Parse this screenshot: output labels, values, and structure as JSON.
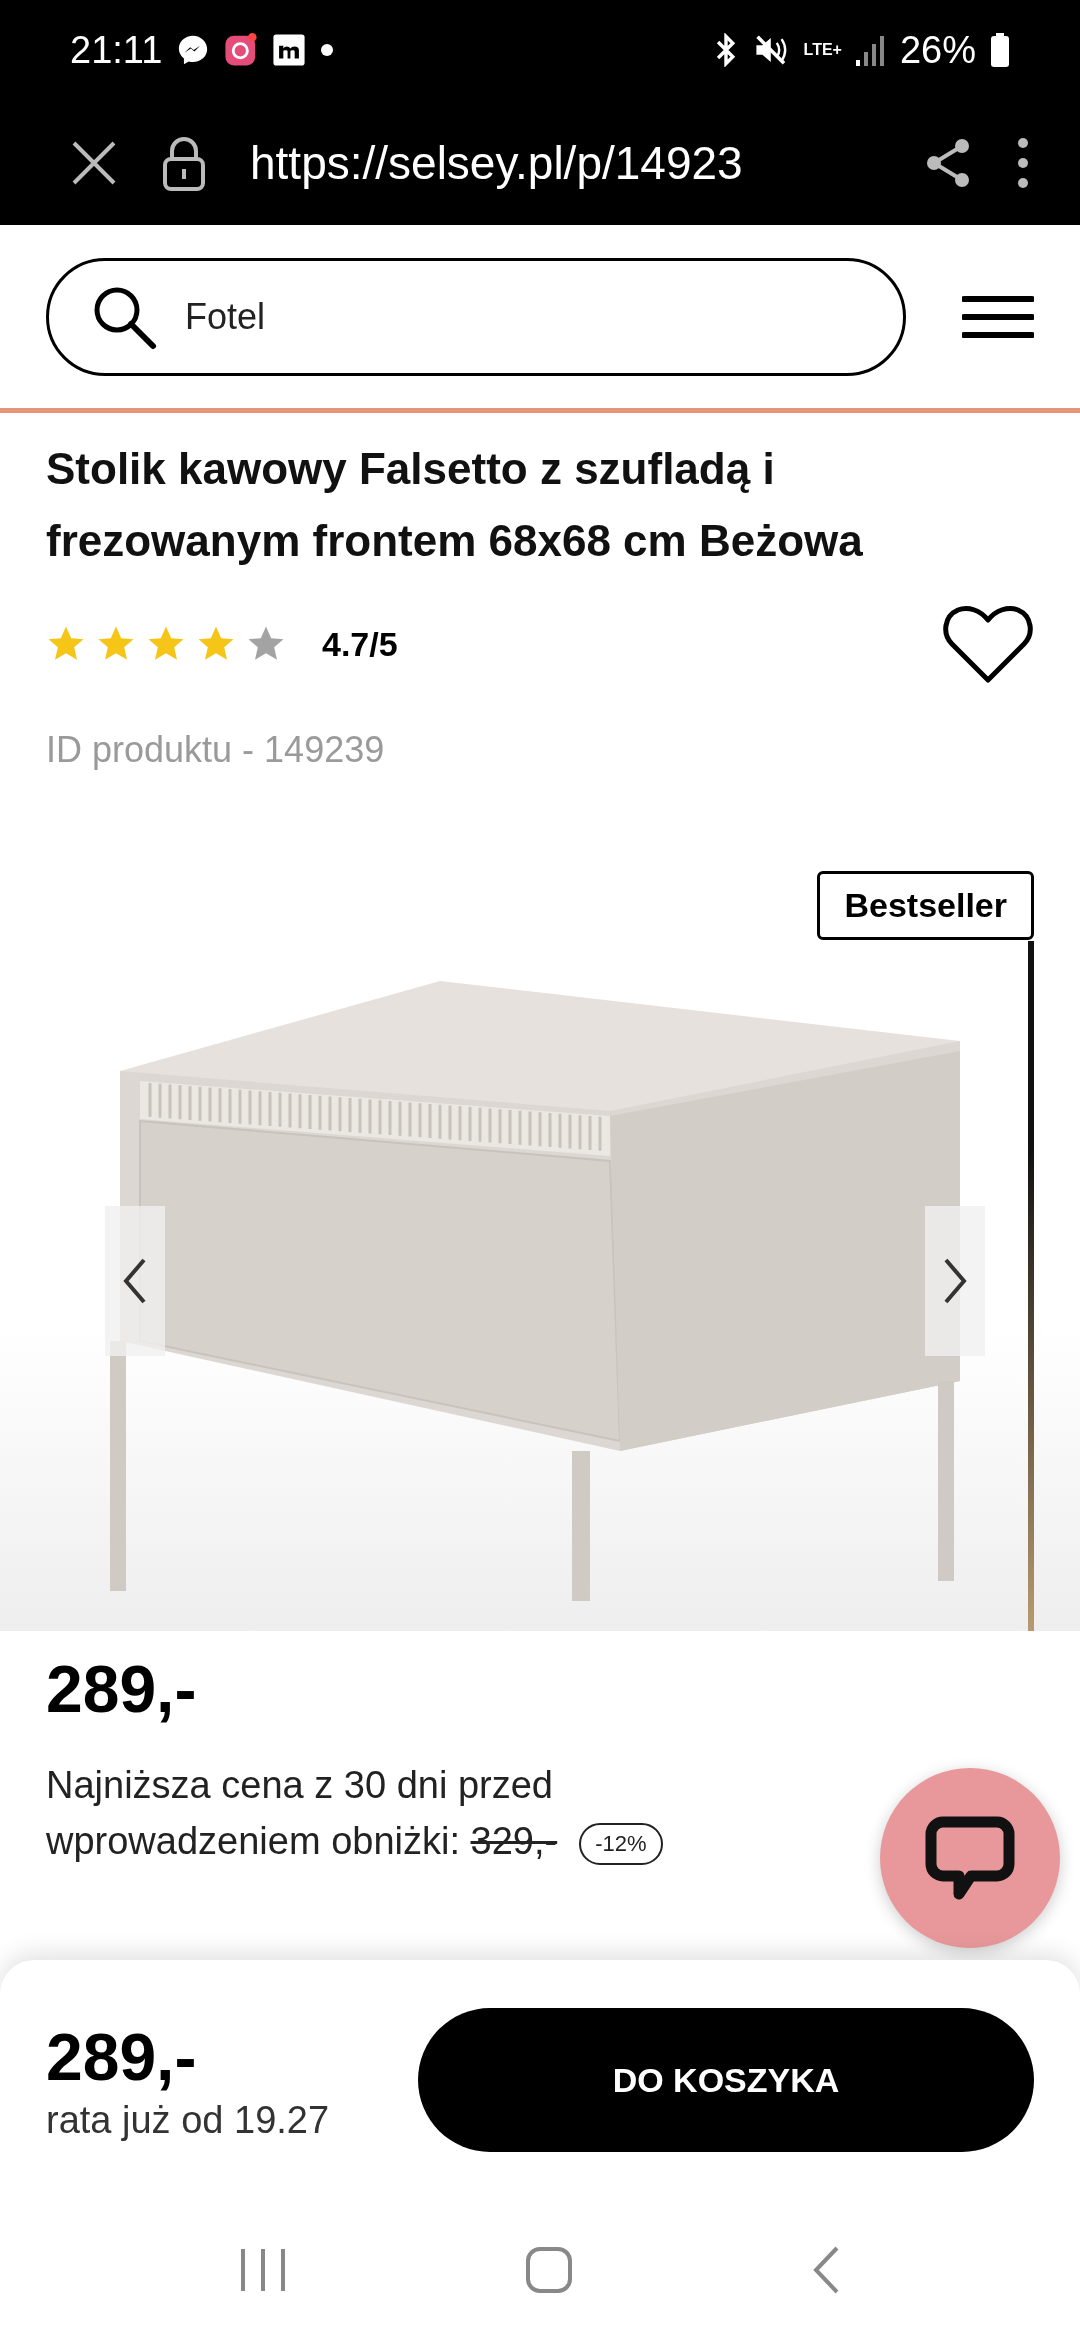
{
  "status_bar": {
    "time": "21:11",
    "network": "LTE+",
    "battery": "26%"
  },
  "browser": {
    "url": "https://selsey.pl/p/14923"
  },
  "search": {
    "value": "Fotel"
  },
  "product": {
    "title": "Stolik kawowy Falsetto z szufladą i frezowanym frontem 68x68 cm Beżowa",
    "stars": 4,
    "rating": "4.7/5",
    "favorite": false,
    "id_label": "ID produktu - 149239",
    "badge": "Bestseller",
    "price": "289,-",
    "lowest_price_note": "Najniższa cena z 30 dni przed wprowadzeniem obniżki:",
    "old_price": "329,-",
    "discount": "-12%"
  },
  "cart_bar": {
    "price": "289,-",
    "installment": "rata już od 19.27",
    "button": "DO KOSZYKA"
  }
}
